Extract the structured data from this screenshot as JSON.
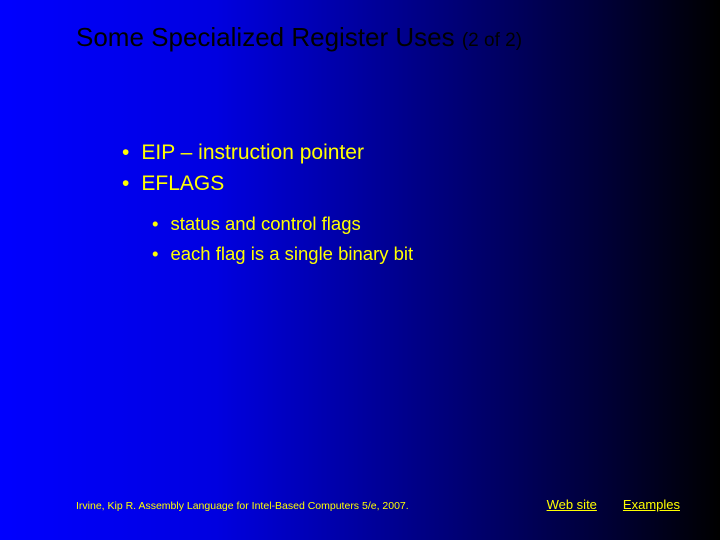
{
  "title": {
    "main": "Some Specialized Register Uses ",
    "sub": "(2 of 2)"
  },
  "bullets_l1": {
    "b0": "EIP – instruction pointer",
    "b1": "EFLAGS"
  },
  "bullets_l2": {
    "b0": "status and control flags",
    "b1": "each flag is a single binary bit"
  },
  "footer": {
    "citation": "Irvine, Kip R. Assembly Language for Intel-Based Computers 5/e, 2007.",
    "link_web": "Web site",
    "link_examples": "Examples"
  }
}
